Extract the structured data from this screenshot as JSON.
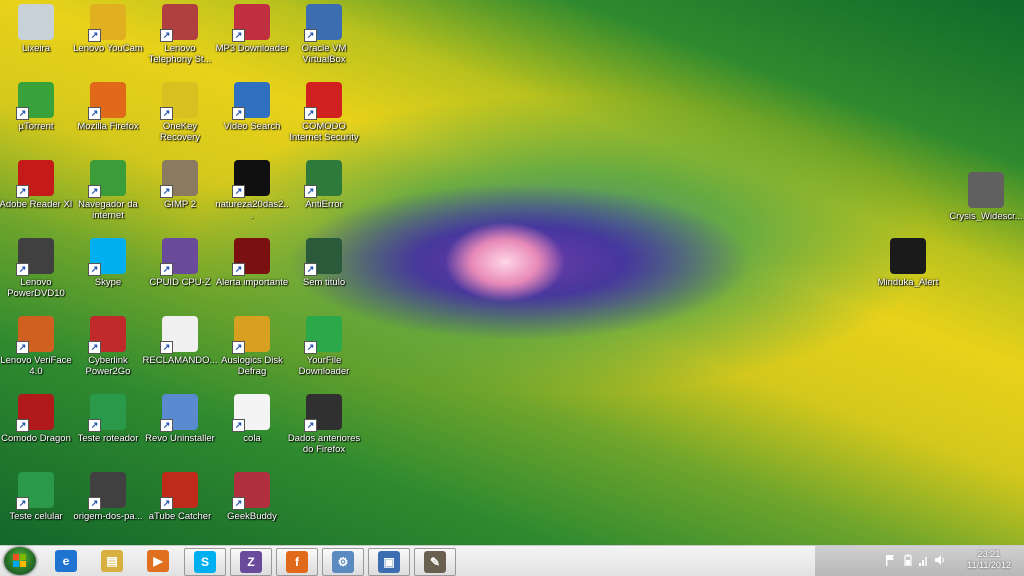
{
  "desktop": {
    "icons": [
      {
        "label": "Lixeira",
        "icon": "recycle-bin-icon",
        "color": "#c8d0d8"
      },
      {
        "label": "Lenovo YouCam",
        "icon": "webcam-icon",
        "color": "#e0b020"
      },
      {
        "label": "Lenovo Telephony St...",
        "icon": "telephony-icon",
        "color": "#b04040"
      },
      {
        "label": "MP3 Downloader",
        "icon": "mp3-downloader-icon",
        "color": "#c03040"
      },
      {
        "label": "Oracle VM VirtualBox",
        "icon": "virtualbox-icon",
        "color": "#3c6db0"
      },
      {
        "label": "µTorrent",
        "icon": "utorrent-icon",
        "color": "#3aa23a"
      },
      {
        "label": "Mozilla Firefox",
        "icon": "firefox-icon",
        "color": "#e06a1a"
      },
      {
        "label": "OneKey Recovery",
        "icon": "onekey-recovery-icon",
        "color": "#d8c020"
      },
      {
        "label": "Video Search",
        "icon": "video-search-icon",
        "color": "#3070c0"
      },
      {
        "label": "COMODO Internet Security",
        "icon": "comodo-shield-icon",
        "color": "#d02020"
      },
      {
        "label": "Adobe Reader XI",
        "icon": "adobe-reader-icon",
        "color": "#c41a1a"
      },
      {
        "label": "Navegador da internet",
        "icon": "chrome-icon",
        "color": "#3a9d3a"
      },
      {
        "label": "GIMP 2",
        "icon": "gimp-icon",
        "color": "#8a7a60"
      },
      {
        "label": "natureza20das2...",
        "icon": "image-file-icon",
        "color": "#101010"
      },
      {
        "label": "AntiError",
        "icon": "antierror-icon",
        "color": "#2e7a3a"
      },
      {
        "label": "Lenovo PowerDVD10",
        "icon": "powerdvd-icon",
        "color": "#404040"
      },
      {
        "label": "Skype",
        "icon": "skype-icon",
        "color": "#00aff0"
      },
      {
        "label": "CPUID CPU-Z",
        "icon": "cpu-z-icon",
        "color": "#6a4a9a"
      },
      {
        "label": "Alerta importante",
        "icon": "alert-image-icon",
        "color": "#7a1010"
      },
      {
        "label": "Sem titulo",
        "icon": "untitled-image-icon",
        "color": "#2a5a3a"
      },
      {
        "label": "Lenovo VeriFace 4.0",
        "icon": "veriface-icon",
        "color": "#d06020"
      },
      {
        "label": "Cyberlink Power2Go",
        "icon": "power2go-icon",
        "color": "#c02a2a"
      },
      {
        "label": "RECLAMANDO...",
        "icon": "document-file-icon",
        "color": "#f0f0f0"
      },
      {
        "label": "Auslogics Disk Defrag",
        "icon": "disk-defrag-icon",
        "color": "#d8a020"
      },
      {
        "label": "YourFile Downloader",
        "icon": "yourfile-icon",
        "color": "#2aa84a"
      },
      {
        "label": "Comodo Dragon",
        "icon": "comodo-dragon-icon",
        "color": "#b01a1a"
      },
      {
        "label": "Teste roteador",
        "icon": "image-file-icon",
        "color": "#2a9a4a"
      },
      {
        "label": "Revo Uninstaller",
        "icon": "revo-uninstaller-icon",
        "color": "#5a8ad0"
      },
      {
        "label": "cola",
        "icon": "document-file-icon",
        "color": "#f4f4f4"
      },
      {
        "label": "Dados anteriores do Firefox",
        "icon": "folder-icon",
        "color": "#303030"
      },
      {
        "label": "Teste celular",
        "icon": "image-file-icon",
        "color": "#2a9a4a"
      },
      {
        "label": "origem-dos-pa...",
        "icon": "image-file-icon",
        "color": "#404040"
      },
      {
        "label": "aTube Catcher",
        "icon": "atube-catcher-icon",
        "color": "#c02a1a"
      },
      {
        "label": "GeekBuddy",
        "icon": "geekbuddy-icon",
        "color": "#b03040"
      }
    ],
    "right_icons": [
      {
        "label": "Crysis_Widescr...",
        "icon": "image-file-icon",
        "color": "#606060"
      },
      {
        "label": "Minduka_Alert",
        "icon": "alert-icon",
        "color": "#1a1a1a"
      }
    ]
  },
  "taskbar": {
    "start": {
      "icon": "windows-start-icon"
    },
    "pinned": [
      {
        "icon": "internet-explorer-icon",
        "glyph": "e",
        "color": "#1e74d0",
        "open": false
      },
      {
        "icon": "file-explorer-icon",
        "glyph": "▤",
        "color": "#d8b040",
        "open": false
      },
      {
        "icon": "media-player-icon",
        "glyph": "▶",
        "color": "#e07020",
        "open": false
      },
      {
        "icon": "skype-icon",
        "glyph": "S",
        "color": "#00aff0",
        "open": true
      },
      {
        "icon": "cpu-z-icon",
        "glyph": "Z",
        "color": "#6a4a9a",
        "open": true
      },
      {
        "icon": "firefox-icon",
        "glyph": "f",
        "color": "#e06a1a",
        "open": true
      },
      {
        "icon": "control-panel-icon",
        "glyph": "⚙",
        "color": "#5a8ac0",
        "open": true
      },
      {
        "icon": "virtualbox-icon",
        "glyph": "▣",
        "color": "#3c6db0",
        "open": true
      },
      {
        "icon": "gimp-icon",
        "glyph": "✎",
        "color": "#6a6050",
        "open": true
      }
    ],
    "tray": {
      "icons": [
        "flag-icon",
        "battery-icon",
        "signal-icon",
        "volume-icon"
      ],
      "time": "23:21",
      "date": "11/11/2012"
    }
  }
}
